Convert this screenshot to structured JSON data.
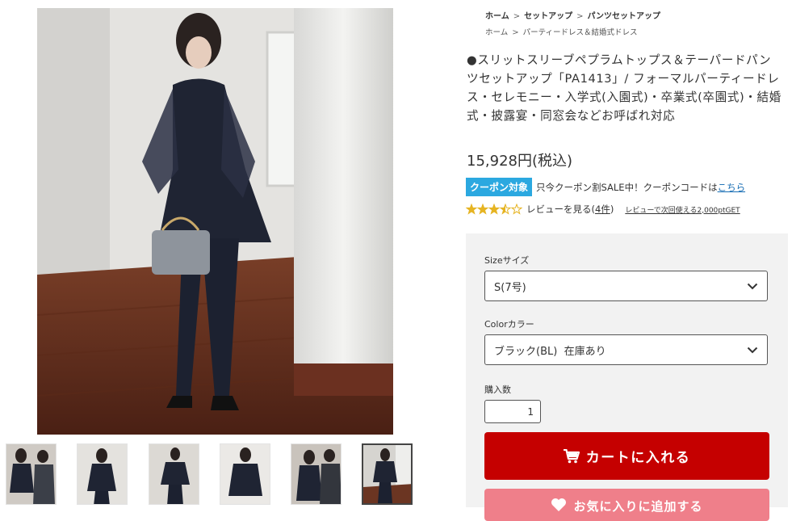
{
  "gallery": {
    "main_image_alt": "モデル着用写真",
    "thumbnails": [
      {
        "name": "thumb-1",
        "active": false
      },
      {
        "name": "thumb-2",
        "active": false
      },
      {
        "name": "thumb-3",
        "active": false
      },
      {
        "name": "thumb-4",
        "active": false
      },
      {
        "name": "thumb-5",
        "active": false
      },
      {
        "name": "thumb-6",
        "active": true
      }
    ]
  },
  "breadcrumbs": {
    "primary": [
      "ホーム",
      "セットアップ",
      "パンツセットアップ"
    ],
    "secondary": [
      "ホーム",
      "パーティードレス＆結婚式ドレス"
    ],
    "separator": ">"
  },
  "product": {
    "title": "●スリットスリーブペプラムトップス＆テーパードパンツセットアップ「PA1413」/ フォーマルパーティードレス・セレモニー・入学式(入園式)・卒業式(卒園式)・結婚式・披露宴・同窓会などお呼ばれ対応",
    "price": "15,928円(税込)"
  },
  "coupon": {
    "badge": "クーポン対象",
    "text": "只今クーポン割SALE中！クーポンコードは",
    "link": "こちら",
    "badge_color": "#2ba8e0"
  },
  "review": {
    "rating": 3.5,
    "max_rating": 5,
    "label_prefix": "レビューを見る(",
    "count": "4件",
    "label_suffix": ")",
    "point_text": "レビューで次回使える2,000ptGET",
    "star_color": "#e6b422"
  },
  "purchase": {
    "size_label": "Sizeサイズ",
    "size_value": "S(7号)",
    "color_label": "Colorカラー",
    "color_value": "ブラック(BL)  在庫あり",
    "qty_label": "購入数",
    "qty_value": "1",
    "cart_button": "カートに入れる",
    "favorite_button": "お気に入りに追加する",
    "cart_color": "#c50000",
    "favorite_color": "#ef7f8a"
  }
}
